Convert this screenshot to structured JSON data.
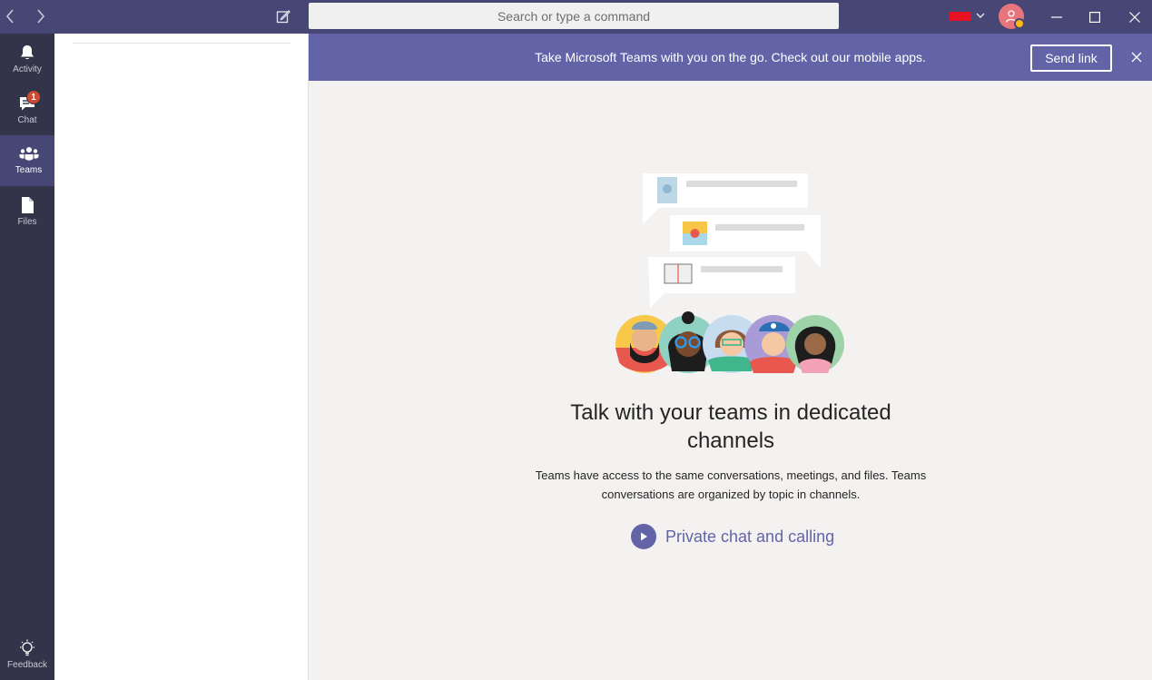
{
  "titlebar": {
    "search_placeholder": "Search or type a command"
  },
  "appbar": {
    "items": [
      {
        "label": "Activity",
        "icon": "bell-icon"
      },
      {
        "label": "Chat",
        "icon": "chat-icon",
        "badge": "1"
      },
      {
        "label": "Teams",
        "icon": "teams-icon",
        "active": true
      },
      {
        "label": "Files",
        "icon": "file-icon"
      }
    ],
    "feedback_label": "Feedback"
  },
  "banner": {
    "message": "Take Microsoft Teams with you on the go. Check out our mobile apps.",
    "send_link_label": "Send link"
  },
  "main": {
    "headline": "Talk with your teams in dedicated channels",
    "subtext": "Teams have access to the same conversations, meetings, and files. Teams conversations are organized by topic in channels.",
    "cta_label": "Private chat and calling"
  },
  "colors": {
    "titlebar": "#464775",
    "appbar": "#33344a",
    "brand": "#6264a7",
    "badge": "#cc4a31",
    "content_bg": "#f3f2f1"
  }
}
